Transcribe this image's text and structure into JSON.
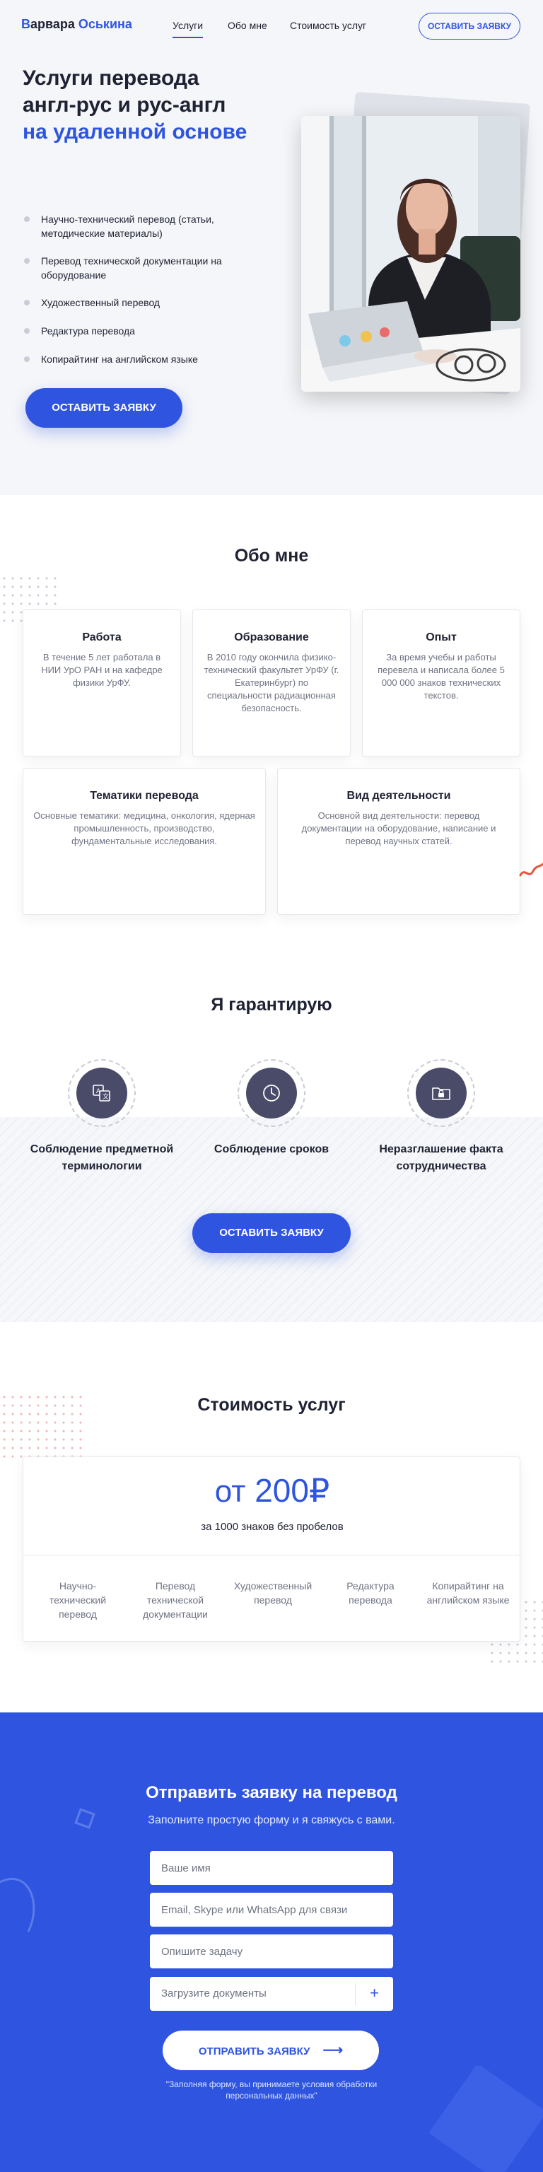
{
  "header": {
    "logo": {
      "part1": "В",
      "part2": "арвара ",
      "part3": "Оськина"
    },
    "nav": [
      {
        "label": "Услуги",
        "active": true
      },
      {
        "label": "Обо мне",
        "active": false
      },
      {
        "label": "Стоимость услуг",
        "active": false
      }
    ],
    "cta_label": "ОСТАВИТЬ ЗАЯВКУ"
  },
  "hero": {
    "title_line1": "Услуги перевода",
    "title_line2": "англ-рус и рус-англ",
    "title_accent": "на удаленной основе",
    "services": [
      "Научно-технический перевод (статьи, методические материалы)",
      "Перевод технической документации на оборудование",
      "Художественный перевод",
      "Редактура перевода",
      "Копирайтинг на английском языке"
    ],
    "cta_label": "ОСТАВИТЬ ЗАЯВКУ"
  },
  "about": {
    "title": "Обо мне",
    "cards": [
      {
        "title": "Работа",
        "text": "В течение 5 лет работала в НИИ УрО РАН и на кафедре физики УрФУ."
      },
      {
        "title": "Образование",
        "text": "В 2010 году окончила физико-технический факультет УрФУ (г. Екатеринбург) по специальности радиационная безопасность."
      },
      {
        "title": "Опыт",
        "text": "За время учебы и работы перевела и написала более 5 000 000 знаков технических текстов."
      },
      {
        "title": "Тематики перевода",
        "text": "Основные тематики: медицина, онкология, ядерная промышленность, производство, фундаментальные исследования."
      },
      {
        "title": "Вид деятельности",
        "text": "Основной вид деятельности: перевод документации на оборудование, написание и перевод научных статей."
      }
    ]
  },
  "guarantee": {
    "title": "Я гарантирую",
    "items": [
      {
        "label": "Соблюдение предметной терминологии",
        "icon": "translate-icon"
      },
      {
        "label": "Соблюдение сроков",
        "icon": "clock-icon"
      },
      {
        "label": "Неразглашение факта сотрудничества",
        "icon": "lock-folder-icon"
      }
    ],
    "cta_label": "ОСТАВИТЬ ЗАЯВКУ"
  },
  "pricing": {
    "title": "Стоимость услуг",
    "price_prefix": "от",
    "price_value": "200₽",
    "price_note": "за 1000 знаков без пробелов",
    "categories": [
      "Научно-технический перевод",
      "Перевод технической документации",
      "Художественный перевод",
      "Редактура перевода",
      "Копирайтинг на английском языке"
    ]
  },
  "form": {
    "title": "Отправить заявку на перевод",
    "subtitle": "Заполните простую форму и я свяжусь с вами.",
    "name_placeholder": "Ваше имя",
    "contact_placeholder": "Email, Skype или WhatsApp для связи",
    "task_placeholder": "Опишите задачу",
    "upload_label": "Загрузите документы",
    "upload_plus": "+",
    "submit_label": "ОТПРАВИТЬ ЗАЯВКУ",
    "submit_arrow": "⟶",
    "note": "\"Заполняя форму, вы принимаете условия обработки персональных данных\""
  },
  "colors": {
    "accent": "#2f55e0",
    "text": "#1f2233",
    "muted": "#6f7383",
    "icon_bg": "#4a4b68",
    "light_bg": "#f5f6f9"
  }
}
